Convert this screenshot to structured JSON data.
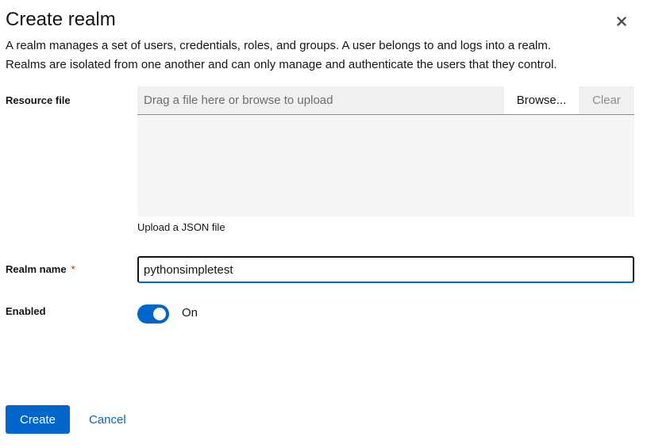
{
  "modal": {
    "title": "Create realm",
    "close_icon": "close-icon",
    "description_line1": "A realm manages a set of users, credentials, roles, and groups. A user belongs to and logs into a realm.",
    "description_line2": "Realms are isolated from one another and can only manage and authenticate the users that they control."
  },
  "form": {
    "resource_file": {
      "label": "Resource file",
      "placeholder": "Drag a file here or browse to upload",
      "browse_label": "Browse...",
      "clear_label": "Clear",
      "helper": "Upload a JSON file"
    },
    "realm_name": {
      "label": "Realm name",
      "required_marker": "*",
      "value": "pythonsimpletest"
    },
    "enabled": {
      "label": "Enabled",
      "state_label": "On",
      "checked": true
    }
  },
  "footer": {
    "create_label": "Create",
    "cancel_label": "Cancel"
  },
  "colors": {
    "primary": "#0066cc",
    "required": "#c9190b",
    "text": "#151515",
    "muted": "#6a6e73"
  }
}
